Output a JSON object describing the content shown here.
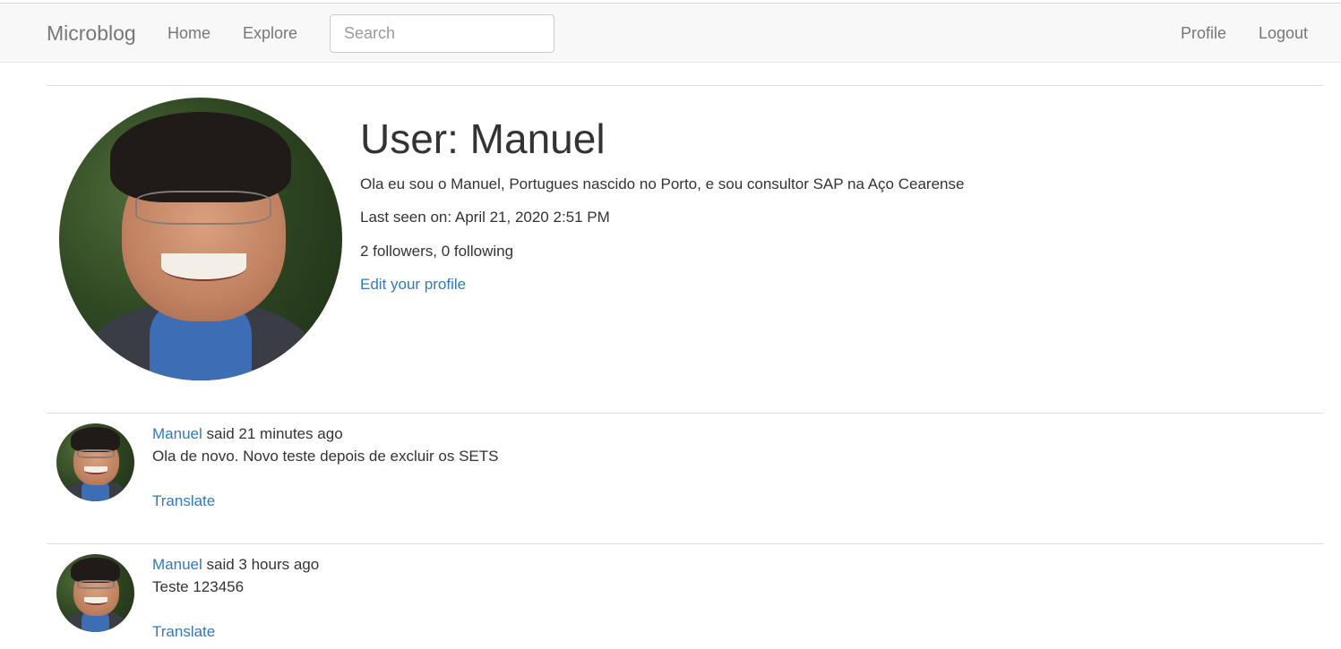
{
  "navbar": {
    "brand": "Microblog",
    "home": "Home",
    "explore": "Explore",
    "search_placeholder": "Search",
    "profile": "Profile",
    "logout": "Logout"
  },
  "profile": {
    "title": "User: Manuel",
    "about": "Ola eu sou o Manuel, Portugues nascido no Porto, e sou consultor SAP na Aço Cearense",
    "last_seen": "Last seen on: April 21, 2020 2:51 PM",
    "follow_counts": "2 followers, 0 following",
    "edit_link": "Edit your profile"
  },
  "posts": [
    {
      "author": "Manuel",
      "said": " said 21 minutes ago",
      "body": "Ola de novo. Novo teste depois de excluir os SETS",
      "translate": "Translate"
    },
    {
      "author": "Manuel",
      "said": " said 3 hours ago",
      "body": "Teste 123456",
      "translate": "Translate"
    }
  ],
  "colors": {
    "link": "#337ab7",
    "navbar_bg": "#f8f8f8",
    "nav_text": "#777777"
  }
}
